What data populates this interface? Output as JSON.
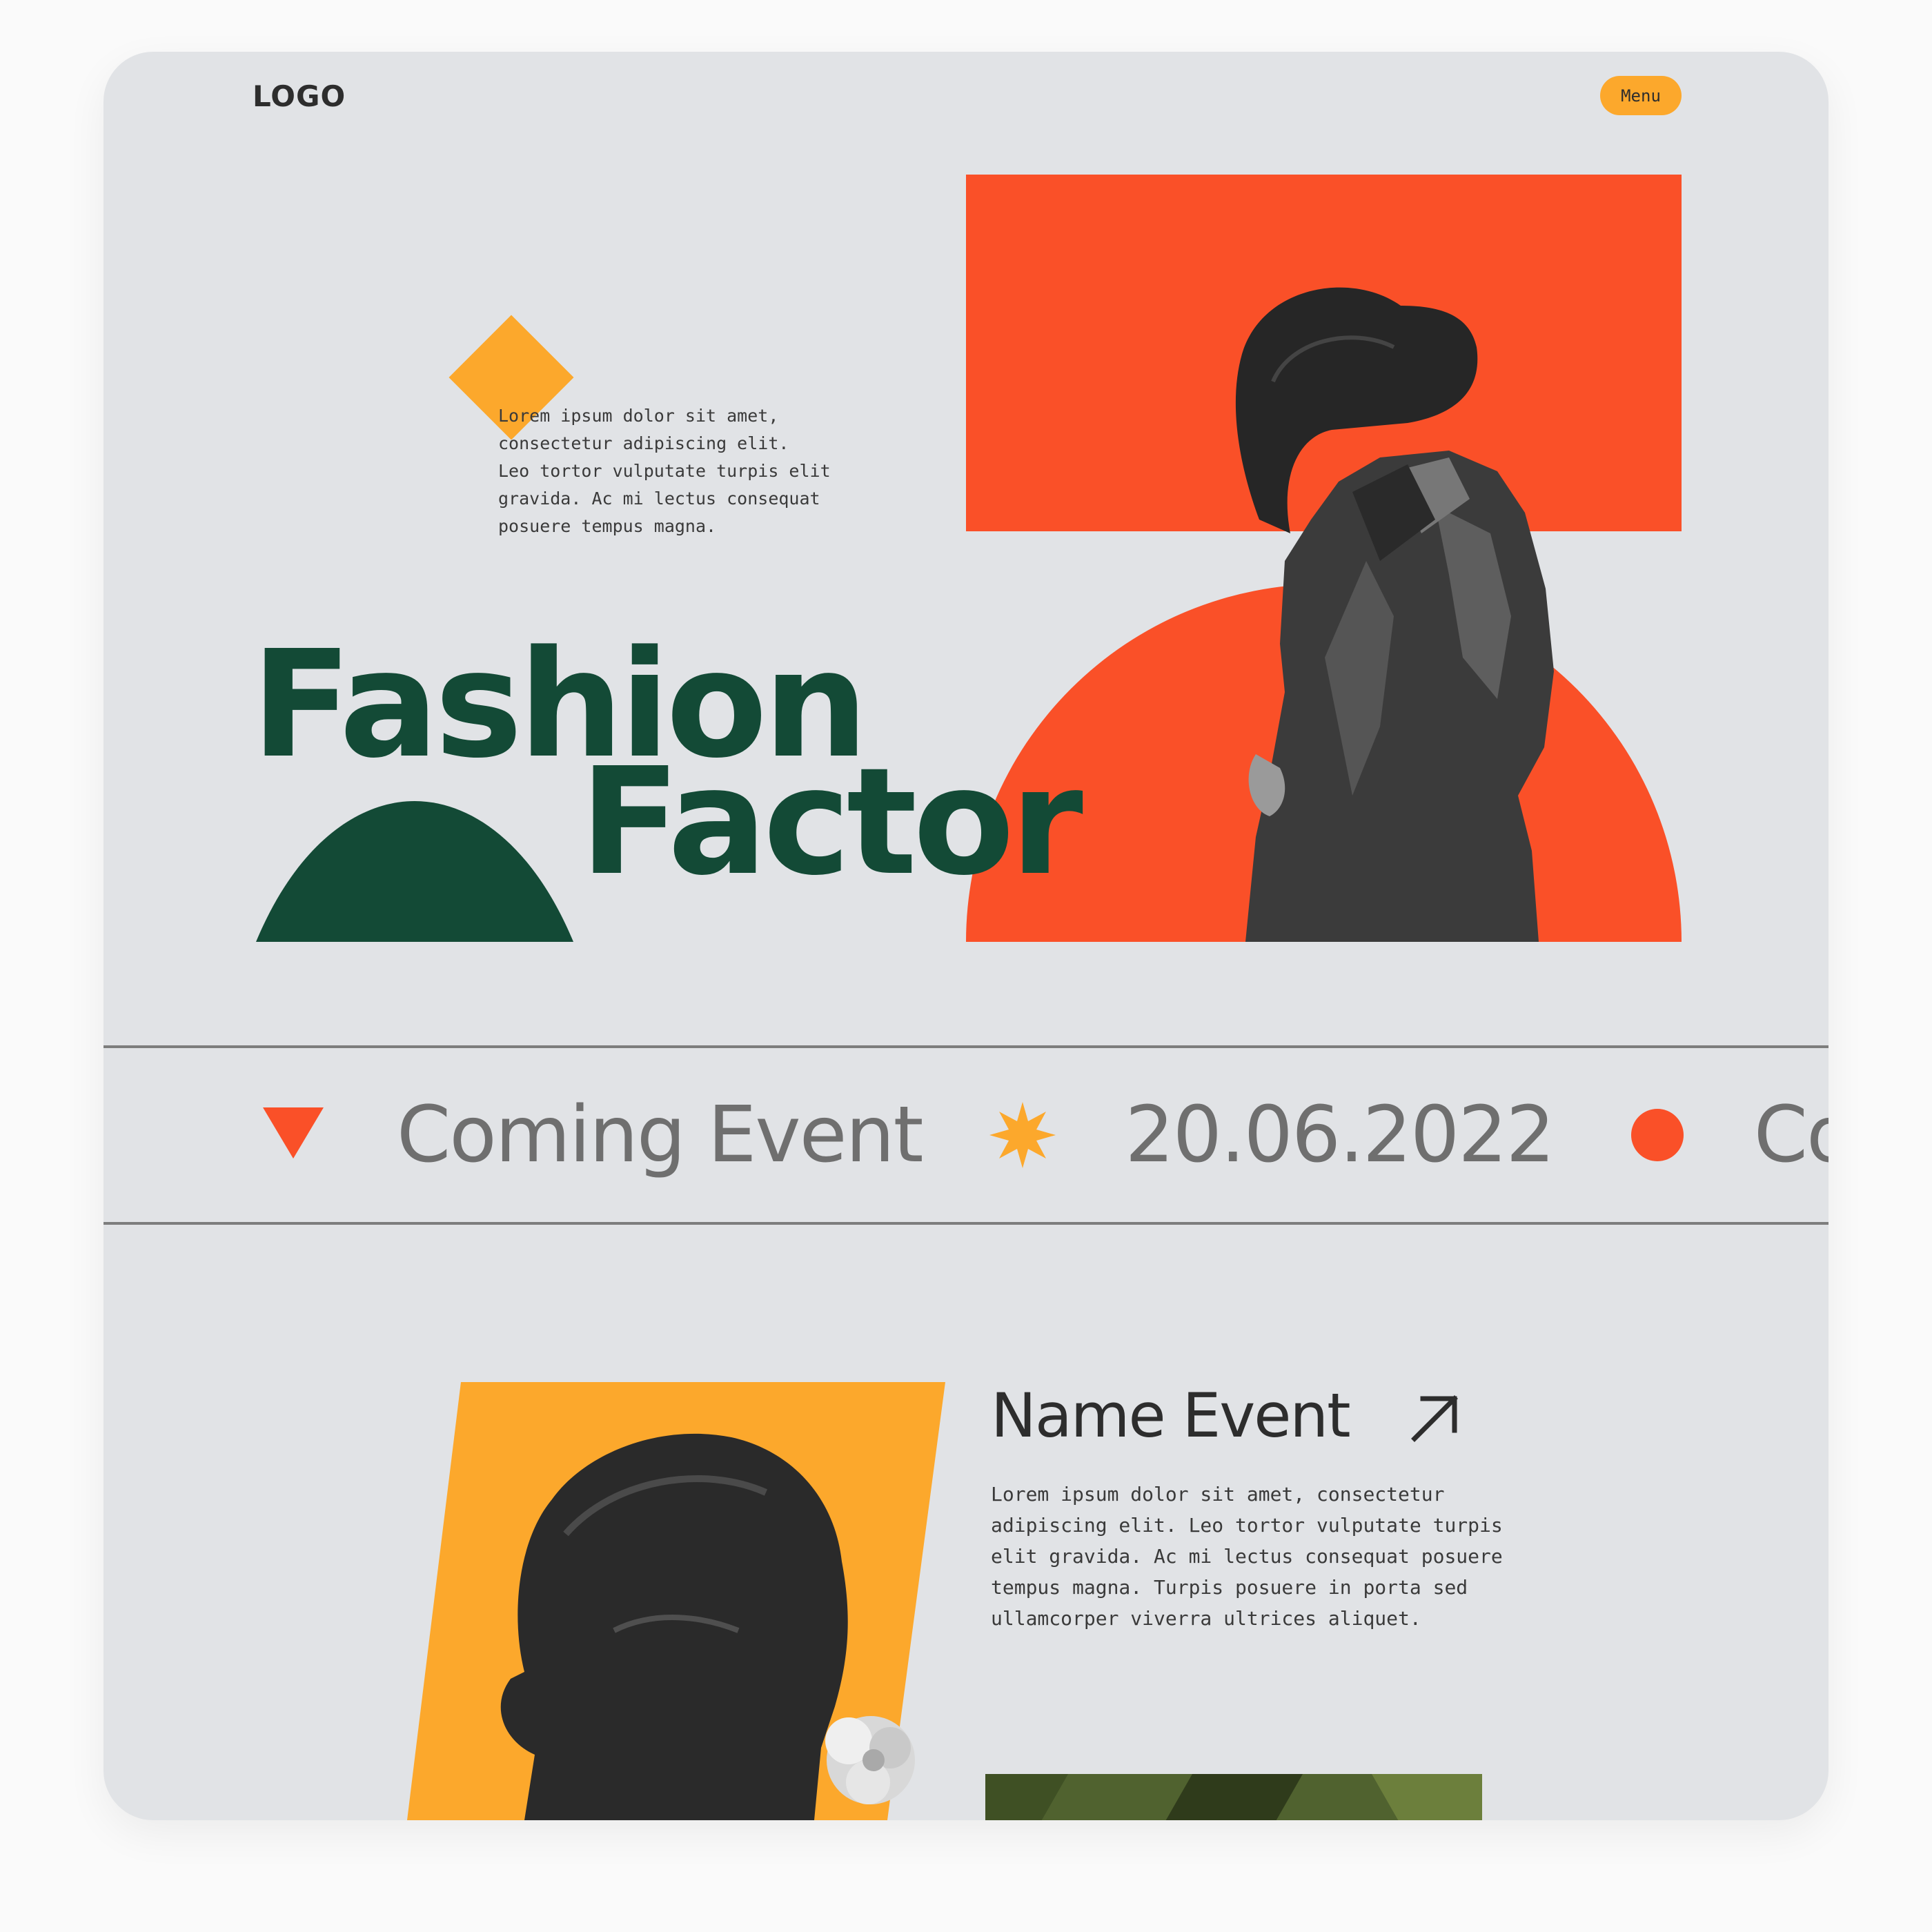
{
  "header": {
    "logo": "LOGO",
    "menu_label": "Menu"
  },
  "hero": {
    "intro_text": "Lorem ipsum dolor sit amet,\nconsectetur adipiscing elit.\nLeo tortor vulputate turpis elit\ngravida. Ac mi lectus consequat\nposuere tempus magna.",
    "title_line1": "Fashion",
    "title_line2": "Factor",
    "image_icon": "woman-leather-jacket-photo"
  },
  "marquee": {
    "items": [
      {
        "symbol": "triangle-down-icon",
        "text": "Coming Event"
      },
      {
        "symbol": "star-burst-icon",
        "text": "20.06.2022"
      },
      {
        "symbol": "circle-icon",
        "text": "Co"
      }
    ]
  },
  "event": {
    "title": "Name Event",
    "arrow_icon": "arrow-up-right-icon",
    "description": "Lorem ipsum dolor sit amet, consectetur\nadipiscing elit. Leo tortor vulputate turpis\nelit gravida. Ac mi lectus consequat posuere\ntempus magna. Turpis posuere in porta sed\nullamcorper viverra ultrices aliquet.",
    "image_icon": "man-with-flower-photo"
  },
  "colors": {
    "background": "#e1e3e6",
    "accent_orange": "#fa5028",
    "accent_yellow": "#fca82c",
    "brand_green": "#134a36",
    "text_gray": "#6f6f6f"
  }
}
